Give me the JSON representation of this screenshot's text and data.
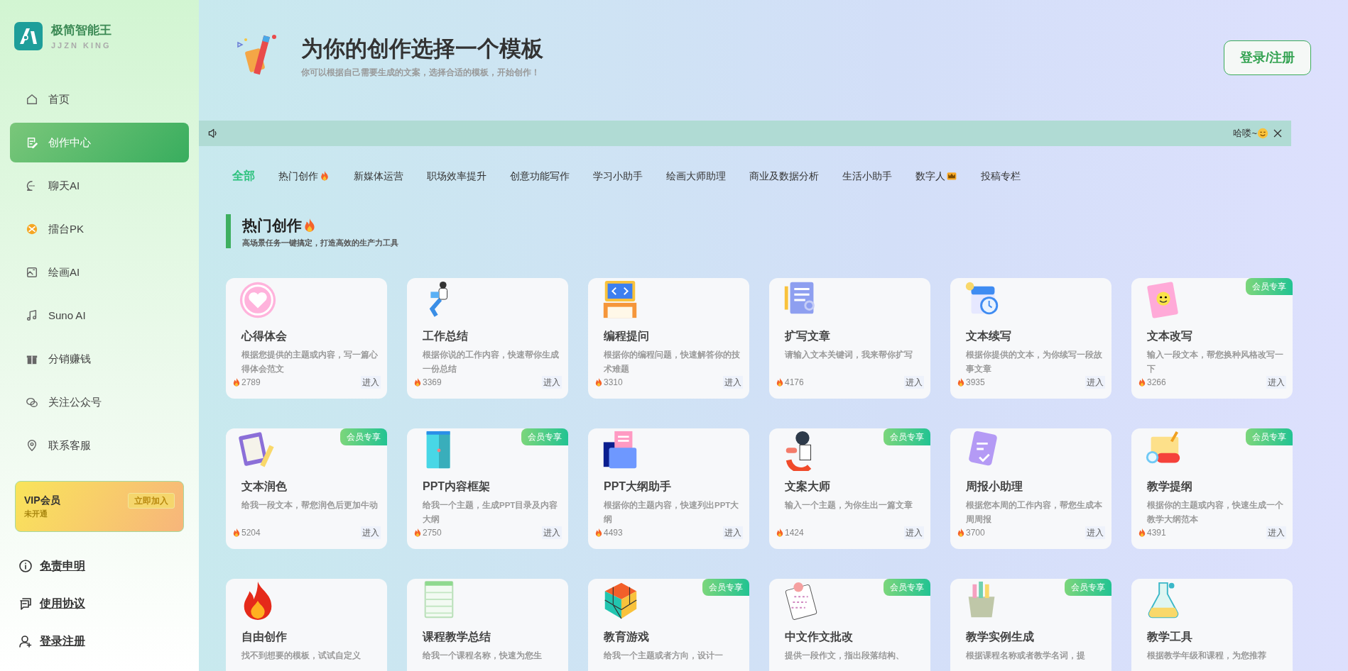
{
  "brand": {
    "name": "极简智能王",
    "subtitle": "JJZN KING"
  },
  "sidebar": {
    "items": [
      {
        "label": "首页",
        "selected": false
      },
      {
        "label": "创作中心",
        "selected": true
      },
      {
        "label": "聊天AI",
        "selected": false
      },
      {
        "label": "擂台PK",
        "selected": false
      },
      {
        "label": "绘画AI",
        "selected": false
      },
      {
        "label": "Suno AI",
        "selected": false
      },
      {
        "label": "分销赚钱",
        "selected": false
      },
      {
        "label": "关注公众号",
        "selected": false
      },
      {
        "label": "联系客服",
        "selected": false
      }
    ],
    "vip": {
      "title": "VIP会员",
      "status": "未开通",
      "button": "立即加入"
    },
    "links": [
      "免责申明",
      "使用协议",
      "登录注册"
    ]
  },
  "header": {
    "title": "为你的创作选择一个模板",
    "subtitle": "你可以根据自己需要生成的文案，选择合适的模板，开始创作！",
    "login_button": "登录/注册"
  },
  "notice": {
    "text": "哈喽~",
    "smiley": true
  },
  "tabs": [
    {
      "label": "全部",
      "selected": true
    },
    {
      "label": "热门创作",
      "selected": false,
      "flame": true
    },
    {
      "label": "新媒体运营",
      "selected": false
    },
    {
      "label": "职场效率提升",
      "selected": false
    },
    {
      "label": "创意功能写作",
      "selected": false
    },
    {
      "label": "学习小助手",
      "selected": false
    },
    {
      "label": "绘画大师助理",
      "selected": false
    },
    {
      "label": "商业及数据分析",
      "selected": false
    },
    {
      "label": "生活小助手",
      "selected": false
    },
    {
      "label": "数字人",
      "selected": false,
      "crown": true
    },
    {
      "label": "投稿专栏",
      "selected": false
    }
  ],
  "section": {
    "title": "热门创作",
    "flame": true,
    "subtitle": "高场景任务一键搞定，打造高效的生产力工具"
  },
  "cards": [
    {
      "title": "心得体会",
      "description": "根据您提供的主题或内容，写一篇心得体会范文",
      "count": "2789",
      "action": "进入"
    },
    {
      "title": "工作总结",
      "description": "根据你说的工作内容，快速帮你生成一份总结",
      "count": "3369",
      "action": "进入"
    },
    {
      "title": "编程提问",
      "description": "根据你的编程问题，快速解答你的技术难题",
      "count": "3310",
      "action": "进入"
    },
    {
      "title": "扩写文章",
      "description": "请输入文本关键词，我来帮你扩写",
      "count": "4176",
      "action": "进入"
    },
    {
      "title": "文本续写",
      "description": "根据你提供的文本，为你续写一段故事文章",
      "count": "3935",
      "action": "进入"
    },
    {
      "title": "文本改写",
      "description": "输入一段文本，帮您换种风格改写一下",
      "count": "3266",
      "action": "进入",
      "badge": "会员专享"
    },
    {
      "title": "文本润色",
      "description": "给我一段文本，帮您润色后更加牛动",
      "count": "5204",
      "action": "进入",
      "badge": "会员专享"
    },
    {
      "title": "PPT内容框架",
      "description": "给我一个主题，生成PPT目录及内容大纲",
      "count": "2750",
      "action": "进入",
      "badge": "会员专享"
    },
    {
      "title": "PPT大纲助手",
      "description": "根据你的主题内容，快速列出PPT大纲",
      "count": "4493",
      "action": "进入"
    },
    {
      "title": "文案大师",
      "description": "输入一个主题，为你生出一篇文章",
      "count": "1424",
      "action": "进入",
      "badge": "会员专享"
    },
    {
      "title": "周报小助理",
      "description": "根据您本周的工作内容，帮您生成本周周报",
      "count": "3700",
      "action": "进入"
    },
    {
      "title": "教学提纲",
      "description": "根据你的主题或内容，快速生成一个教学大纲范本",
      "count": "4391",
      "action": "进入",
      "badge": "会员专享"
    },
    {
      "title": "自由创作",
      "description": "找不到想要的模板，试试自定义"
    },
    {
      "title": "课程教学总结",
      "description": "给我一个课程名称，快速为您生"
    },
    {
      "title": "教育游戏",
      "description": "给我一个主题或者方向，设计一",
      "badge": "会员专享"
    },
    {
      "title": "中文作文批改",
      "description": "提供一段作文，指出段落结构、",
      "badge": "会员专享"
    },
    {
      "title": "教学实例生成",
      "description": "根据课程名称或者教学名词，提",
      "badge": "会员专享"
    },
    {
      "title": "教学工具",
      "description": "根据教学年级和课程，为您推荐"
    }
  ]
}
